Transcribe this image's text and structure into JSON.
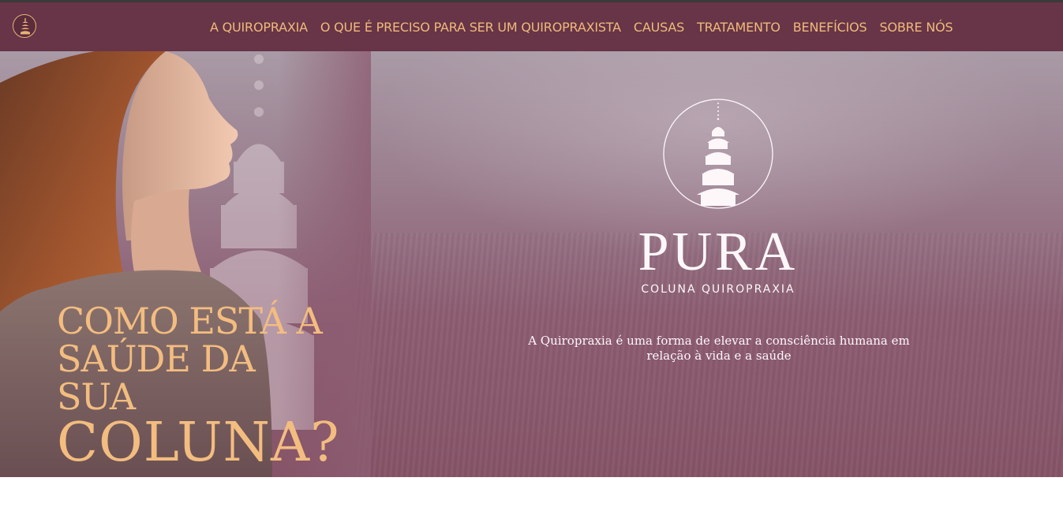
{
  "nav": {
    "logo_icon": "pagoda-logo-icon",
    "items": [
      {
        "label": "A QUIROPRAXIA"
      },
      {
        "label": "O QUE É PRECISO PARA SER UM QUIROPRAXISTA"
      },
      {
        "label": "CAUSAS"
      },
      {
        "label": "TRATAMENTO"
      },
      {
        "label": "BENEFÍCIOS"
      },
      {
        "label": "SOBRE NÓS"
      }
    ]
  },
  "hero": {
    "headline_line1": "COMO ESTÁ A",
    "headline_line2": "SAÚDE DA SUA",
    "headline_line3": "COLUNA?",
    "brand_name": "PURA",
    "brand_sub": "COLUNA QUIROPRAXIA",
    "tagline": "A Quiropraxia é uma forma de elevar a consciência humana em relação à vida e a saúde"
  },
  "colors": {
    "nav_bg": "#673547",
    "accent": "#f0b97b",
    "hero_bottom": "#865467",
    "text_light": "#fdf7f9"
  }
}
